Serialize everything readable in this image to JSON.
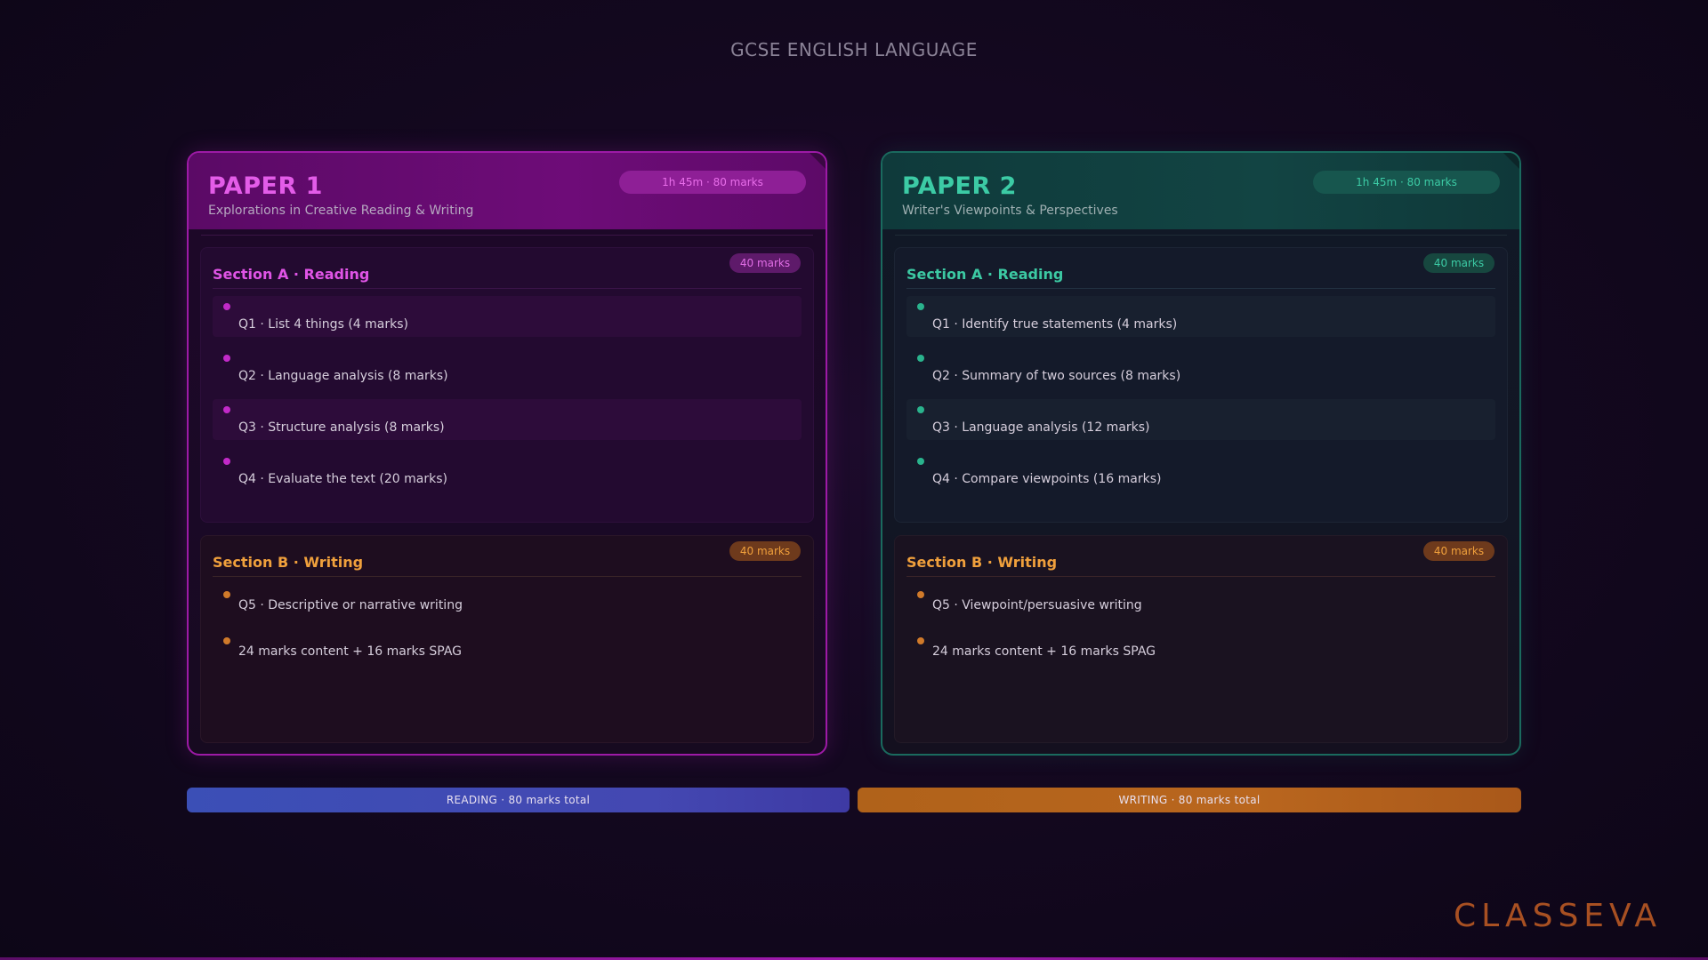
{
  "page_title": "GCSE ENGLISH LANGUAGE",
  "papers": [
    {
      "title": "PAPER 1",
      "subtitle": "Explorations in Creative Reading & Writing",
      "time_marks": "1h 45m · 80 marks",
      "section_a": {
        "title": "Section A · Reading",
        "marks": "40 marks",
        "questions": [
          "Q1 · List 4 things (4 marks)",
          "Q2 · Language analysis (8 marks)",
          "Q3 · Structure analysis (8 marks)",
          "Q4 · Evaluate the text (20 marks)"
        ]
      },
      "section_b": {
        "title": "Section B · Writing",
        "marks": "40 marks",
        "items": [
          "Q5 · Descriptive or narrative writing",
          "24 marks content + 16 marks SPAG"
        ]
      }
    },
    {
      "title": "PAPER 2",
      "subtitle": "Writer's Viewpoints & Perspectives",
      "time_marks": "1h 45m · 80 marks",
      "section_a": {
        "title": "Section A · Reading",
        "marks": "40 marks",
        "questions": [
          "Q1 · Identify true statements (4 marks)",
          "Q2 · Summary of two sources (8 marks)",
          "Q3 · Language analysis (12 marks)",
          "Q4 · Compare viewpoints (16 marks)"
        ]
      },
      "section_b": {
        "title": "Section B · Writing",
        "marks": "40 marks",
        "items": [
          "Q5 · Viewpoint/persuasive writing",
          "24 marks content + 16 marks SPAG"
        ]
      }
    }
  ],
  "totals": {
    "reading": "READING · 80 marks total",
    "writing": "WRITING · 80 marks total"
  },
  "logo": "CLASSEVA",
  "colors": {
    "paper1_accent": "#e35ce8",
    "paper2_accent": "#3ccba5",
    "writing_accent": "#f0a03c",
    "reading_bar": "#3b4fb6",
    "writing_bar": "#b0621a"
  }
}
